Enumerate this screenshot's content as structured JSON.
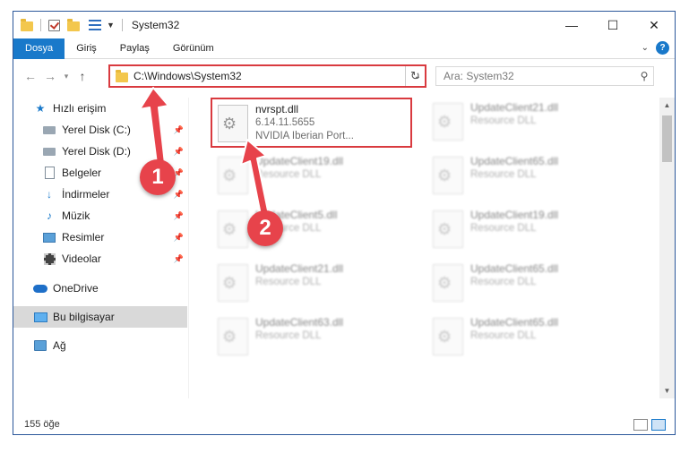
{
  "window": {
    "title": "System32",
    "controls": {
      "minimize": "—",
      "maximize": "☐",
      "close": "✕"
    }
  },
  "ribbon": {
    "tabs": [
      {
        "label": "Dosya",
        "active": true
      },
      {
        "label": "Giriş",
        "active": false
      },
      {
        "label": "Paylaş",
        "active": false
      },
      {
        "label": "Görünüm",
        "active": false
      }
    ],
    "expand_icon": "chevron-down-icon",
    "help": "?"
  },
  "nav": {
    "back": "←",
    "forward": "→",
    "recent": "▾",
    "up": "↑",
    "address": "C:\\Windows\\System32",
    "address_dropdown": "⌄",
    "refresh": "↻",
    "search_placeholder": "Ara: System32",
    "search_glyph": "⚲"
  },
  "sidebar": {
    "items": [
      {
        "label": "Hızlı erişim",
        "icon": "star-icon",
        "pinned": false,
        "selected": false
      },
      {
        "label": "Yerel Disk (C:)",
        "icon": "drive-icon",
        "pinned": true,
        "selected": false
      },
      {
        "label": "Yerel Disk (D:)",
        "icon": "drive-icon",
        "pinned": true,
        "selected": false
      },
      {
        "label": "Belgeler",
        "icon": "document-icon",
        "pinned": true,
        "selected": false
      },
      {
        "label": "İndirmeler",
        "icon": "download-icon",
        "pinned": true,
        "selected": false
      },
      {
        "label": "Müzik",
        "icon": "music-icon",
        "pinned": true,
        "selected": false
      },
      {
        "label": "Resimler",
        "icon": "pictures-icon",
        "pinned": true,
        "selected": false
      },
      {
        "label": "Videolar",
        "icon": "videos-icon",
        "pinned": true,
        "selected": false
      },
      {
        "label": "OneDrive",
        "icon": "cloud-icon",
        "pinned": false,
        "selected": false
      },
      {
        "label": "Bu bilgisayar",
        "icon": "computer-icon",
        "pinned": false,
        "selected": true
      },
      {
        "label": "Ağ",
        "icon": "network-icon",
        "pinned": false,
        "selected": false
      }
    ],
    "pin_glyph": "📌"
  },
  "files": [
    {
      "name": "nvrspt.dll",
      "line2": "6.14.11.5655",
      "line3": "NVIDIA Iberian Port...",
      "highlighted": true
    },
    {
      "name": "UpdateClient21.dll",
      "line2": "Resource DLL"
    },
    {
      "name": "UpdateClient19.dll",
      "line2": "Resource DLL"
    },
    {
      "name": "UpdateClient65.dll",
      "line2": "Resource DLL"
    },
    {
      "name": "UpdateClient5.dll",
      "line2": "Resource DLL"
    },
    {
      "name": "UpdateClient19.dll",
      "line2": "Resource DLL"
    },
    {
      "name": "UpdateClient21.dll",
      "line2": "Resource DLL"
    },
    {
      "name": "UpdateClient65.dll",
      "line2": "Resource DLL"
    },
    {
      "name": "UpdateClient63.dll",
      "line2": "Resource DLL"
    },
    {
      "name": "UpdateClient65.dll",
      "line2": "Resource DLL"
    }
  ],
  "status": {
    "item_count": "155 öğe"
  },
  "annotations": {
    "step1": "1",
    "step2": "2",
    "color": "#e7434b"
  }
}
